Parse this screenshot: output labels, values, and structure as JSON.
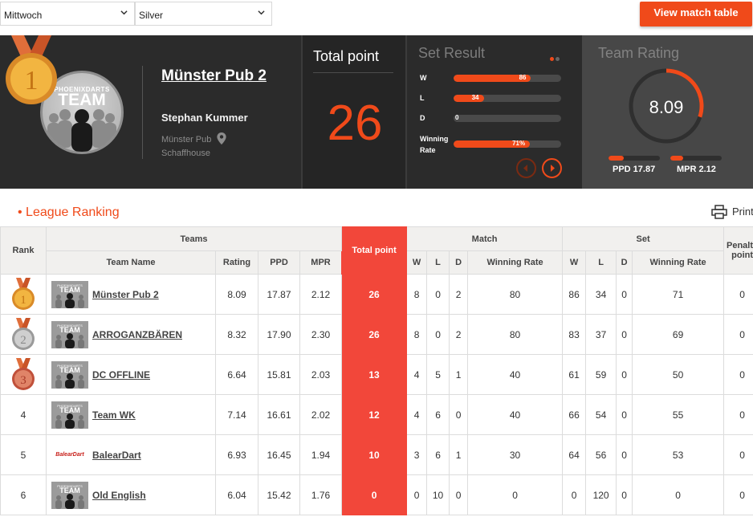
{
  "filters": {
    "day": "Mittwoch",
    "league": "Silver",
    "view_button": "View match table"
  },
  "team_card": {
    "name": "Münster Pub 2",
    "captain": "Stephan Kummer",
    "venue": "Münster Pub Schaffhouse",
    "rank": "1",
    "logo_line1": "PHOENIXDARTS",
    "logo_line2": "TEAM"
  },
  "total_point": {
    "title": "Total point",
    "value": "26"
  },
  "set_result": {
    "title": "Set Result",
    "rows": [
      {
        "label": "W",
        "value": "86",
        "fraction": 0.72
      },
      {
        "label": "L",
        "value": "34",
        "fraction": 0.28
      },
      {
        "label": "D",
        "value": "0",
        "fraction": 0
      },
      {
        "label": "Winning Rate",
        "value": "71%",
        "fraction": 0.71
      }
    ]
  },
  "team_rating": {
    "title": "Team Rating",
    "value": "8.09",
    "gauge_fraction": 0.3,
    "ppd_label": "PPD 17.87",
    "ppd_fraction": 0.3,
    "mpr_label": "MPR 2.12",
    "mpr_fraction": 0.25
  },
  "colors": {
    "accent": "#f04a1a",
    "total_col": "#f2473a",
    "dark_panel": "#2b2b2b",
    "gold": "#e8a33a",
    "silver": "#b8b8b8",
    "bronze": "#d8684e"
  },
  "league_ranking": {
    "title": "League Ranking",
    "print": "Print",
    "headers": {
      "rank": "Rank",
      "teams": "Teams",
      "team_name": "Team Name",
      "rating": "Rating",
      "ppd": "PPD",
      "mpr": "MPR",
      "total_point": "Total point",
      "match": "Match",
      "set": "Set",
      "w": "W",
      "l": "L",
      "d": "D",
      "winning_rate": "Winning Rate",
      "penalty": "Penalty point"
    },
    "rows": [
      {
        "rank": "1",
        "medal": "gold",
        "logo": "team",
        "team": "Münster Pub 2",
        "rating": "8.09",
        "ppd": "17.87",
        "mpr": "2.12",
        "total": "26",
        "mw": "8",
        "ml": "0",
        "md": "2",
        "mrate": "80",
        "sw": "86",
        "sl": "34",
        "sd": "0",
        "srate": "71",
        "penalty": "0"
      },
      {
        "rank": "2",
        "medal": "silver",
        "logo": "team",
        "team": "ARROGANZBÄREN",
        "rating": "8.32",
        "ppd": "17.90",
        "mpr": "2.30",
        "total": "26",
        "mw": "8",
        "ml": "0",
        "md": "2",
        "mrate": "80",
        "sw": "83",
        "sl": "37",
        "sd": "0",
        "srate": "69",
        "penalty": "0"
      },
      {
        "rank": "3",
        "medal": "bronze",
        "logo": "team",
        "team": "DC OFFLINE",
        "rating": "6.64",
        "ppd": "15.81",
        "mpr": "2.03",
        "total": "13",
        "mw": "4",
        "ml": "5",
        "md": "1",
        "mrate": "40",
        "sw": "61",
        "sl": "59",
        "sd": "0",
        "srate": "50",
        "penalty": "0"
      },
      {
        "rank": "4",
        "medal": "",
        "logo": "team",
        "team": "Team WK",
        "rating": "7.14",
        "ppd": "16.61",
        "mpr": "2.02",
        "total": "12",
        "mw": "4",
        "ml": "6",
        "md": "0",
        "mrate": "40",
        "sw": "66",
        "sl": "54",
        "sd": "0",
        "srate": "55",
        "penalty": "0"
      },
      {
        "rank": "5",
        "medal": "",
        "logo": "BalearDart",
        "team": "BalearDart",
        "rating": "6.93",
        "ppd": "16.45",
        "mpr": "1.94",
        "total": "10",
        "mw": "3",
        "ml": "6",
        "md": "1",
        "mrate": "30",
        "sw": "64",
        "sl": "56",
        "sd": "0",
        "srate": "53",
        "penalty": "0"
      },
      {
        "rank": "6",
        "medal": "",
        "logo": "team",
        "team": "Old English",
        "rating": "6.04",
        "ppd": "15.42",
        "mpr": "1.76",
        "total": "0",
        "mw": "0",
        "ml": "10",
        "md": "0",
        "mrate": "0",
        "sw": "0",
        "sl": "120",
        "sd": "0",
        "srate": "0",
        "penalty": "0"
      }
    ]
  }
}
